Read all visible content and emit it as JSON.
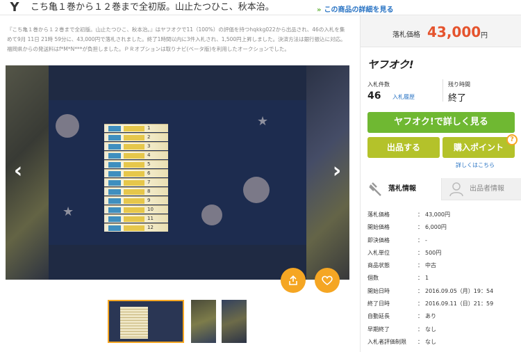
{
  "header": {
    "logo": "Y",
    "title": "こち亀１巻から１２巻まで全初版。山止たつひこ、秋本治。",
    "detail_link": "この商品の詳細を見る",
    "detail_arrow": "»"
  },
  "description": "『こち亀１巻から１２巻まで全初版。山止たつひこ、秋本治。』はヤフオクで11（100%）の評価を持つhqkkg022から出品され、46の入札を集めて9月 11日 21時 59分に、43,000円で落札されました。終了1時間以内に3件入札され、1,500円上昇しました。決済方法は銀行振込に対応。福岡県からの発送料はf*M*N***が負担しました。ＰＲオプションは取りナビ(ベータ版)を利用したオークションでした。",
  "gallery": {
    "prev": "‹",
    "next": "›",
    "book_numbers": [
      "1",
      "2",
      "3",
      "4",
      "5",
      "6",
      "7",
      "8",
      "9",
      "10",
      "11",
      "12"
    ]
  },
  "panel": {
    "price_label": "落札価格",
    "price_value": "43,000",
    "price_unit": "円",
    "logo": "ヤフオク!",
    "bids_label": "入札件数",
    "bids_value": "46",
    "bid_history": "入札履歴",
    "time_label": "残り時間",
    "time_value": "終了",
    "main_button": "ヤフオク!で詳しく見る",
    "listing_button": "出品する",
    "points_button": "購入ポイント",
    "help": "?",
    "more_link": "詳しくはこちら",
    "tab_auction": "落札情報",
    "tab_seller": "出品者情報"
  },
  "info": [
    {
      "k": "落札価格",
      "v": "43,000円"
    },
    {
      "k": "開始価格",
      "v": "6,000円"
    },
    {
      "k": "即決価格",
      "v": "-"
    },
    {
      "k": "入札単位",
      "v": "500円"
    },
    {
      "k": "商品状態",
      "v": "中古"
    },
    {
      "k": "個数",
      "v": "1"
    },
    {
      "k": "開始日時",
      "v": "2016.09.05（月）19：54"
    },
    {
      "k": "終了日時",
      "v": "2016.09.11（日）21：59"
    },
    {
      "k": "自動延長",
      "v": "あり"
    },
    {
      "k": "早期終了",
      "v": "なし"
    },
    {
      "k": "入札者評価制限",
      "v": "なし"
    }
  ],
  "icons": {
    "share": "share-icon",
    "watch": "heart-icon",
    "hammer": "gavel-icon",
    "user": "user-icon"
  },
  "colors": {
    "price": "#e5532d",
    "main_button": "#6fb832",
    "sub_button": "#b4c22a",
    "accent": "#f5a623",
    "link": "#2a74c4"
  }
}
